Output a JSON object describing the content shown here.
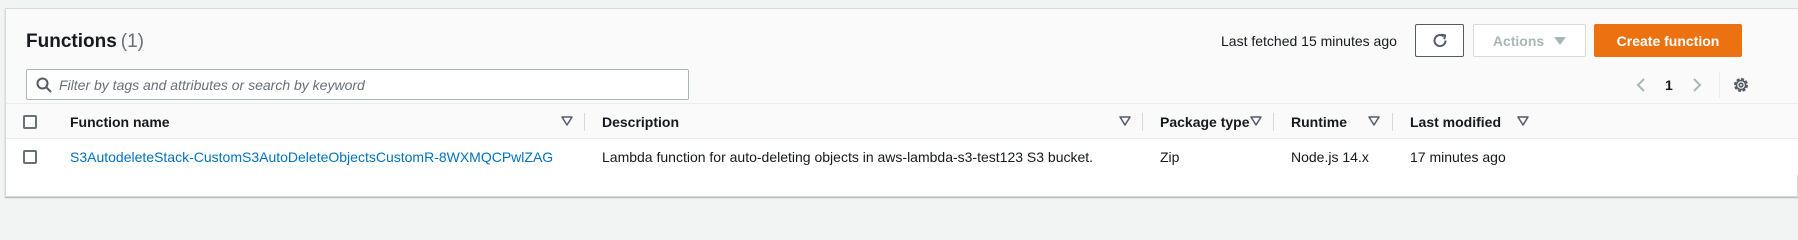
{
  "header": {
    "title": "Functions",
    "count": "(1)",
    "last_fetched": "Last fetched 15 minutes ago",
    "actions_label": "Actions",
    "create_label": "Create function"
  },
  "search": {
    "placeholder": "Filter by tags and attributes or search by keyword",
    "value": ""
  },
  "pagination": {
    "current_page": "1"
  },
  "table": {
    "columns": [
      "Function name",
      "Description",
      "Package type",
      "Runtime",
      "Last modified"
    ],
    "rows": [
      {
        "function_name": "S3AutodeleteStack-CustomS3AutoDeleteObjectsCustomR-8WXMQCPwlZAG",
        "description": "Lambda function for auto-deleting objects in aws-lambda-s3-test123 S3 bucket.",
        "package_type": "Zip",
        "runtime": "Node.js 14.x",
        "last_modified": "17 minutes ago"
      }
    ]
  },
  "colors": {
    "primary_orange": "#ec7211",
    "link_blue": "#0073bb",
    "text": "#16191f",
    "muted": "#687078"
  },
  "icons": [
    "refresh-icon",
    "caret-down-icon",
    "search-icon",
    "chevron-left-icon",
    "chevron-right-icon",
    "settings-gear-icon",
    "sort-icon"
  ]
}
